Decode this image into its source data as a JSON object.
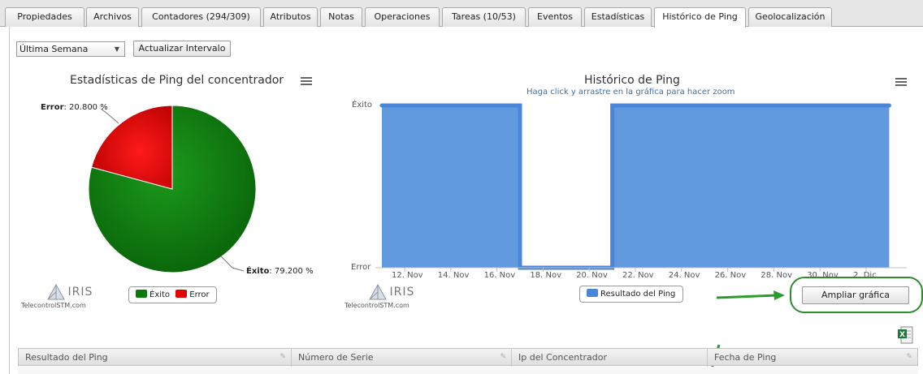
{
  "tabs": [
    {
      "label": "Propiedades",
      "left": 6,
      "width": 98,
      "active": false
    },
    {
      "label": "Archivos",
      "left": 106,
      "width": 65,
      "active": false
    },
    {
      "label": "Contadores (294/309)",
      "left": 174,
      "width": 147,
      "active": false
    },
    {
      "label": "Atributos",
      "left": 324,
      "width": 67,
      "active": false
    },
    {
      "label": "Notas",
      "left": 394,
      "width": 52,
      "active": false
    },
    {
      "label": "Operaciones",
      "left": 449,
      "width": 92,
      "active": false
    },
    {
      "label": "Tareas (10/53)",
      "left": 544,
      "width": 103,
      "active": false
    },
    {
      "label": "Eventos",
      "left": 650,
      "width": 66,
      "active": false
    },
    {
      "label": "Estadísticas",
      "left": 719,
      "width": 83,
      "active": false
    },
    {
      "label": "Histórico de Ping",
      "left": 805,
      "width": 113,
      "active": true
    },
    {
      "label": "Geolocalización",
      "left": 921,
      "width": 103,
      "active": false
    }
  ],
  "controls": {
    "interval_select": "Última Semana",
    "update_button": "Actualizar Intervalo"
  },
  "pie_chart": {
    "title": "Estadísticas de Ping del concentrador",
    "error_label_name": "Error",
    "error_label_value": ": 20.800 %",
    "success_label_name": "Éxito",
    "success_label_value": ": 79.200 %",
    "legend": [
      "Éxito",
      "Error"
    ]
  },
  "line_chart": {
    "title": "Histórico de Ping",
    "subtitle": "Haga click y arrastre en la gráfica para hacer zoom",
    "y_top_label": "Éxito",
    "y_bottom_label": "Error",
    "x_ticks": [
      "12. Nov",
      "14. Nov",
      "16. Nov",
      "18. Nov",
      "20. Nov",
      "22. Nov",
      "24. Nov",
      "26. Nov",
      "28. Nov",
      "30. Nov",
      "2. Dic"
    ],
    "legend": "Resultado del Ping",
    "zoom_button": "Ampliar gráfica"
  },
  "branding": {
    "logo_word": "IRIS",
    "site": "TelecontrolSTM.com"
  },
  "grid": {
    "columns": [
      "Resultado del Ping",
      "Número de Serie",
      "Ip del Concentrador",
      "Fecha de Ping"
    ]
  },
  "colors": {
    "success_green": "#0a7a0a",
    "error_red": "#e00000",
    "series_blue": "#6199df",
    "series_line": "#4a86d8",
    "highlight_green": "#2e8b2e"
  },
  "chart_data": [
    {
      "type": "pie",
      "title": "Estadísticas de Ping del concentrador",
      "labels": [
        "Éxito",
        "Error"
      ],
      "values": [
        79.2,
        20.8
      ],
      "colors": [
        "#0a7a0a",
        "#e00000"
      ],
      "legend": "bottom"
    },
    {
      "type": "area",
      "title": "Histórico de Ping",
      "subtitle": "Haga click y arrastre en la gráfica para hacer zoom",
      "x_ticks": [
        "12. Nov",
        "14. Nov",
        "16. Nov",
        "18. Nov",
        "20. Nov",
        "22. Nov",
        "24. Nov",
        "26. Nov",
        "28. Nov",
        "30. Nov",
        "2. Dic"
      ],
      "y_categories": [
        "Error",
        "Éxito"
      ],
      "series": [
        {
          "name": "Resultado del Ping",
          "x": [
            "10. Nov",
            "17. Nov",
            "17. Nov",
            "21. Nov",
            "21. Nov",
            "3. Dic"
          ],
          "values": [
            "Éxito",
            "Éxito",
            "Error",
            "Error",
            "Éxito",
            "Éxito"
          ]
        }
      ],
      "legend": "bottom"
    }
  ]
}
